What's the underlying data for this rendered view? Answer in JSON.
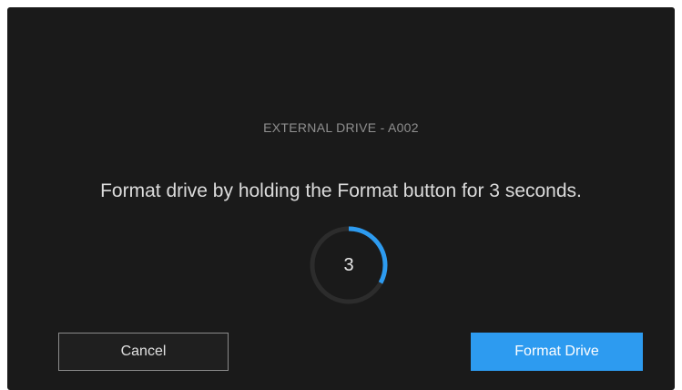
{
  "dialog": {
    "drive_label": "EXTERNAL DRIVE - A002",
    "instruction": "Format drive by holding the Format button for 3 seconds.",
    "countdown": {
      "value": "3",
      "progress_fraction": 0.33
    },
    "cancel_label": "Cancel",
    "format_label": "Format Drive"
  },
  "colors": {
    "background": "#1a1a1a",
    "accent": "#2d9bf0",
    "ring_track": "#2c2c2c"
  }
}
